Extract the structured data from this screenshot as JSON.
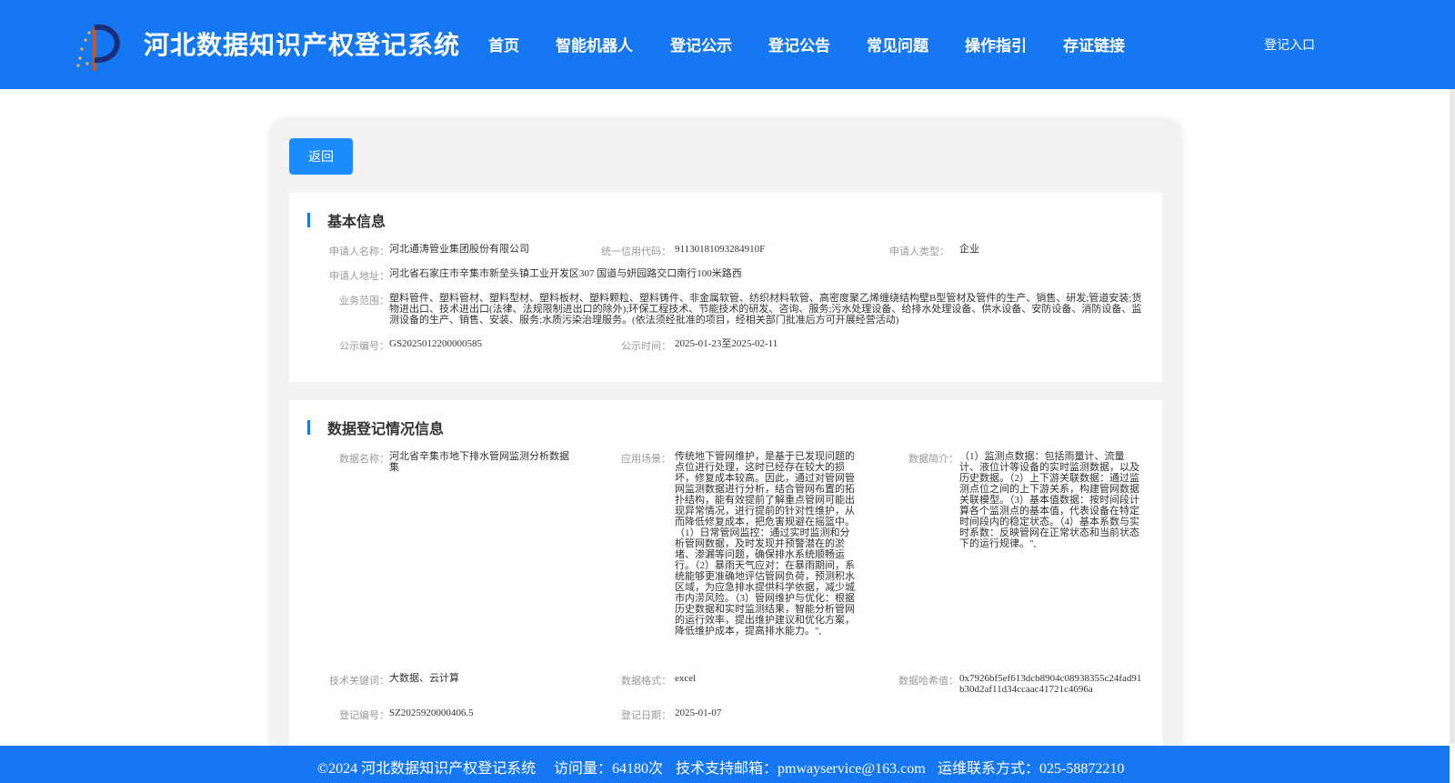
{
  "header": {
    "title": "河北数据知识产权登记系统",
    "nav": [
      "首页",
      "智能机器人",
      "登记公示",
      "登记公告",
      "常见问题",
      "操作指引",
      "存证链接"
    ],
    "login": "登记入口"
  },
  "main": {
    "back_label": "返回",
    "basic": {
      "title": "基本信息",
      "applicant_name_label": "申请人名称：",
      "applicant_name": "河北通涛管业集团股份有限公司",
      "credit_code_label": "统一信用代码：",
      "credit_code": "91130181093284910F",
      "applicant_type_label": "申请人类型：",
      "applicant_type": "企业",
      "address_label": "申请人地址：",
      "address": "河北省石家庄市辛集市新垒头镇工业开发区307 国道与妍园路交口南行100米路西",
      "business_scope_label": "业务范围：",
      "business_scope": "塑料管件、塑料管材、塑料型材、塑料板材、塑料颗粒、塑料铸件、非金属软管、纺织材料软管、高密度聚乙烯缠绕结构壁B型管材及管件的生产、销售、研发;管道安装;货物进出口、技术进出口(法律、法规限制进出口的除外);环保工程技术、节能技术的研发、咨询、服务;污水处理设备、给排水处理设备、供水设备、安防设备、消防设备、监测设备的生产、销售、安装、服务;水质污染治理服务。(依法须经批准的项目，经相关部门批准后方可开展经营活动)",
      "notice_no_label": "公示编号：",
      "notice_no": "GS2025012200000585",
      "notice_time_label": "公示时间：",
      "notice_time": "2025-01-23至2025-02-11"
    },
    "registration": {
      "title": "数据登记情况信息",
      "data_name_label": "数据名称：",
      "data_name": "河北省辛集市地下排水管网监测分析数据集",
      "scenario_label": "应用场景：",
      "scenario": "传统地下管网维护，是基于已发现问题的点位进行处理，这时已经存在较大的损坏，修复成本较高。因此，通过对管网管网监测数据进行分析，结合管网布置的拓扑结构，能有效提前了解重点管网可能出现异常情况，进行提前的针对性维护，从而降低修复成本，把危害规避在摇篮中。（1）日常管网监控：通过实时监测和分析管网数据，及时发现并预警潜在的淤堵、渗漏等问题，确保排水系统顺畅运行。（2）暴雨天气应对：在暴雨期间，系统能够更准确地评估管网负荷，预测积水区域，为应急排水提供科学依据，减少城市内涝风险。（3）管网维护与优化：根据历史数据和实时监测结果，智能分析管网的运行效率，提出维护建议和优化方案，降低维护成本，提高排水能力。\",",
      "summary_label": "数据简介：",
      "summary": "（1）监测点数据：包括雨量计、流量计、液位计等设备的实时监测数据，以及历史数据。（2）上下游关联数据：通过监测点位之间的上下游关系，构建管网数据关联模型。（3）基本值数据：按时间段计算各个监测点的基本值，代表设备在特定时间段内的稳定状态。（4）基本系数与实时系数：反映管网在正常状态和当前状态下的运行规律。\",",
      "keywords_label": "技术关键词：",
      "keywords": "大数据、云计算",
      "format_label": "数据格式：",
      "format": "excel",
      "hash_label": "数据哈希值：",
      "hash": "0x7926bf5ef613dcb8904c08938355c24fad91b30d2af11d34ccaac41721c4696a",
      "reg_no_label": "登记编号：",
      "reg_no": "SZ2025920000406.5",
      "reg_date_label": "登记日期：",
      "reg_date": "2025-01-07"
    }
  },
  "footer": {
    "copyright": "©2024 河北数据知识产权登记系统",
    "visits": "访问量：64180次",
    "email": "技术支持邮箱：pmwayservice@163.com",
    "phone": "运维联系方式：025-58872210"
  },
  "colors": {
    "primary": "#1677f2",
    "button": "#1a8cff",
    "panel": "#f2f2f2"
  }
}
